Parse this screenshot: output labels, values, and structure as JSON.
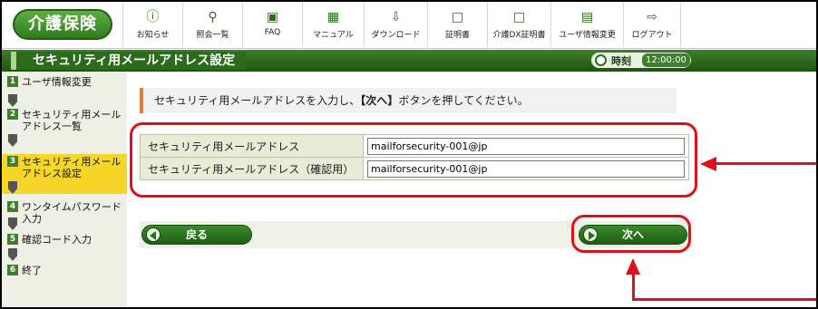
{
  "app": {
    "logo": "介護保険"
  },
  "nav": {
    "items": [
      {
        "label": "お知らせ",
        "icon": "notice-icon"
      },
      {
        "label": "照会一覧",
        "icon": "search-icon"
      },
      {
        "label": "FAQ",
        "icon": "faq-icon"
      },
      {
        "label": "マニュアル",
        "icon": "manual-icon"
      },
      {
        "label": "ダウンロード",
        "icon": "download-icon"
      },
      {
        "label": "証明書",
        "icon": "certificate-icon"
      },
      {
        "label": "介護DX証明書",
        "icon": "dx-certificate-icon"
      },
      {
        "label": "ユーザ情報変更",
        "icon": "user-info-icon"
      },
      {
        "label": "ログアウト",
        "icon": "logout-icon"
      }
    ]
  },
  "header": {
    "title": "セキュリティ用メールアドレス設定",
    "clock_label": "時刻",
    "clock_time": "12:00:00"
  },
  "sidebar": {
    "steps": [
      {
        "num": "1",
        "label": "ユーザ情報変更"
      },
      {
        "num": "2",
        "label": "セキュリティ用メールアドレス一覧"
      },
      {
        "num": "3",
        "label": "セキュリティ用メールアドレス設定",
        "active": true
      },
      {
        "num": "4",
        "label": "ワンタイムパスワード入力"
      },
      {
        "num": "5",
        "label": "確認コード入力"
      },
      {
        "num": "6",
        "label": "終了"
      }
    ]
  },
  "main": {
    "instruction_pre": "セキュリティ用メールアドレスを入力し、",
    "instruction_bold": "【次へ】",
    "instruction_post": "ボタンを押してください。",
    "fields": [
      {
        "label": "セキュリティ用メールアドレス",
        "value": "mailforsecurity-001@jp"
      },
      {
        "label": "セキュリティ用メールアドレス（確認用）",
        "value": "mailforsecurity-001@jp"
      }
    ],
    "back_label": "戻る",
    "next_label": "次へ"
  },
  "colors": {
    "brand": "#3f7f2c",
    "accent_red": "#e0101a",
    "active_step": "#f5d629"
  }
}
